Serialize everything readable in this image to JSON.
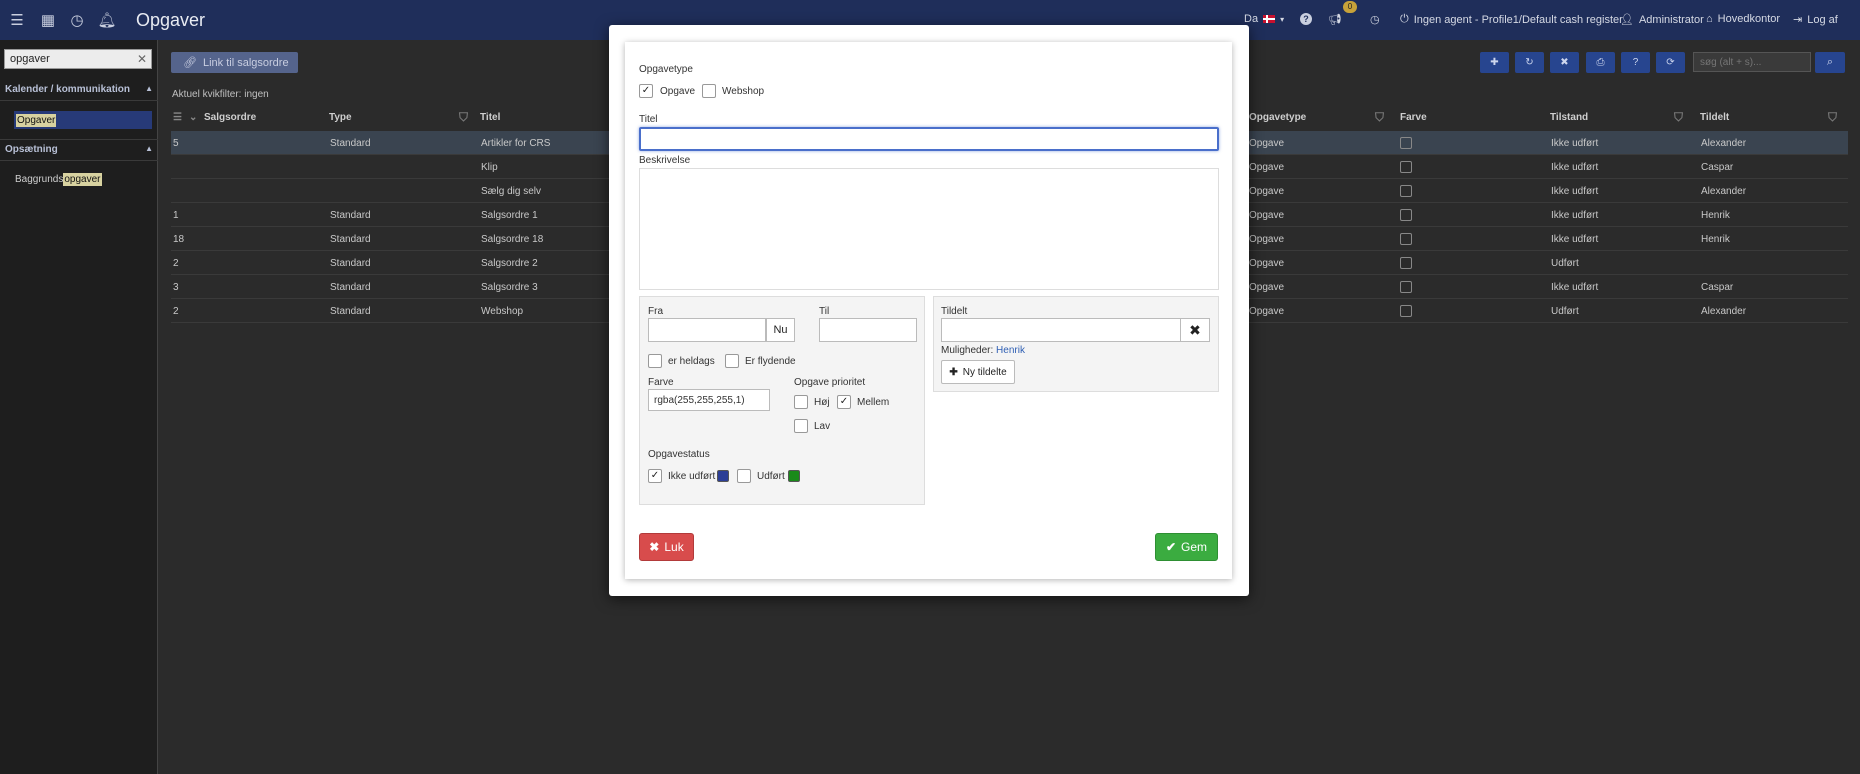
{
  "topbar": {
    "title": "Opgaver",
    "language": "Da",
    "notification_count": "0",
    "agent": "Ingen agent - Profile1/Default cash register",
    "user": "Administrator",
    "location": "Hovedkontor",
    "logout": "Log af"
  },
  "sidebar": {
    "search_value": "opgaver",
    "section1": "Kalender / kommunikation",
    "item1": "Opgaver",
    "section2": "Opsætning",
    "item2_prefix": "Baggrunds",
    "item2_highlight": "opgaver"
  },
  "main": {
    "link_button": "Link til salgsordre",
    "filter_text": "Aktuel kvikfilter: ingen",
    "search_placeholder": "søg (alt + s)..."
  },
  "grid": {
    "headers": {
      "salgsordre": "Salgsordre",
      "type": "Type",
      "titel": "Titel",
      "opgavetype": "Opgavetype",
      "farve": "Farve",
      "tilstand": "Tilstand",
      "tildelt": "Tildelt"
    },
    "rows": [
      {
        "salgsordre": "5",
        "type": "Standard",
        "titel": "Artikler for CRS",
        "opgavetype": "Opgave",
        "tilstand": "Ikke udført",
        "tildelt": "Alexander"
      },
      {
        "salgsordre": "",
        "type": "",
        "titel": "Klip",
        "opgavetype": "Opgave",
        "tilstand": "Ikke udført",
        "tildelt": "Caspar"
      },
      {
        "salgsordre": "",
        "type": "",
        "titel": "Sælg dig selv",
        "opgavetype": "Opgave",
        "tilstand": "Ikke udført",
        "tildelt": "Alexander"
      },
      {
        "salgsordre": "1",
        "type": "Standard",
        "titel": "Salgsordre 1",
        "opgavetype": "Opgave",
        "tilstand": "Ikke udført",
        "tildelt": "Henrik"
      },
      {
        "salgsordre": "18",
        "type": "Standard",
        "titel": "Salgsordre 18",
        "opgavetype": "Opgave",
        "tilstand": "Ikke udført",
        "tildelt": "Henrik"
      },
      {
        "salgsordre": "2",
        "type": "Standard",
        "titel": "Salgsordre 2",
        "opgavetype": "Opgave",
        "tilstand": "Udført",
        "tildelt": ""
      },
      {
        "salgsordre": "3",
        "type": "Standard",
        "titel": "Salgsordre 3",
        "opgavetype": "Opgave",
        "tilstand": "Ikke udført",
        "tildelt": "Caspar"
      },
      {
        "salgsordre": "2",
        "type": "Standard",
        "titel": "Webshop",
        "opgavetype": "Opgave",
        "tilstand": "Udført",
        "tildelt": "Alexander"
      }
    ]
  },
  "modal": {
    "opgavetype_label": "Opgavetype",
    "opgave_label": "Opgave",
    "webshop_label": "Webshop",
    "titel_label": "Titel",
    "titel_value": "",
    "beskrivelse_label": "Beskrivelse",
    "fra_label": "Fra",
    "nu_button": "Nu",
    "til_label": "Til",
    "heldags_label": "er heldags",
    "flydende_label": "Er flydende",
    "farve_label": "Farve",
    "farve_value": "rgba(255,255,255,1)",
    "prioritet_label": "Opgave prioritet",
    "hoj_label": "Høj",
    "mellem_label": "Mellem",
    "lav_label": "Lav",
    "status_label": "Opgavestatus",
    "ikke_udfort_label": "Ikke udført",
    "udfort_label": "Udført",
    "ikke_udfort_color": "#2c3e96",
    "udfort_color": "#1a8a1a",
    "tildelt_label": "Tildelt",
    "muligheder_label": "Muligheder:",
    "muligheder_value": "Henrik",
    "ny_tildelte": "Ny tildelte",
    "close_button": "Luk",
    "save_button": "Gem"
  }
}
